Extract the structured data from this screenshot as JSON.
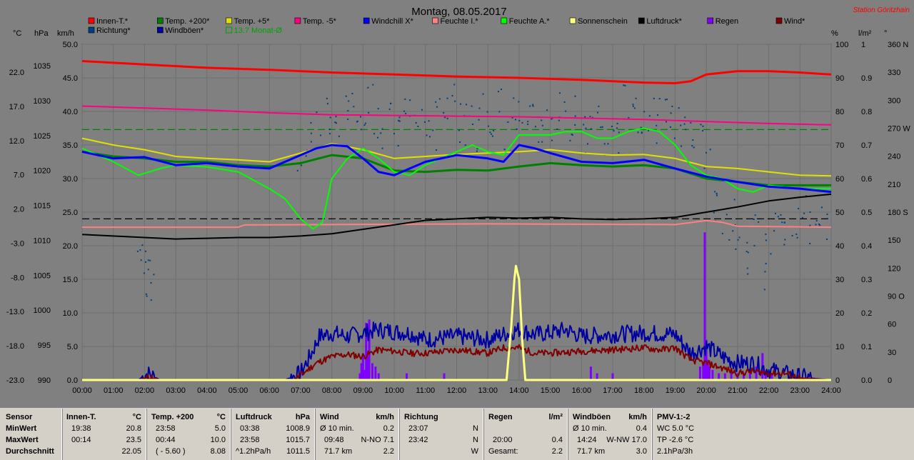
{
  "title": "Montag, 08.05.2017",
  "station": "Station Göritzhain",
  "legend": [
    {
      "label": "Innen-T.*",
      "color": "#ff0000"
    },
    {
      "label": "Temp. +200*",
      "color": "#008000"
    },
    {
      "label": "Temp. +5*",
      "color": "#e0e000"
    },
    {
      "label": "Temp. -5*",
      "color": "#ff0080"
    },
    {
      "label": "Windchill X*",
      "color": "#0000ff"
    },
    {
      "label": "Feuchte I.*",
      "color": "#ff8080"
    },
    {
      "label": "Feuchte A.*",
      "color": "#00ff00"
    },
    {
      "label": "Sonnenschein",
      "color": "#ffff80"
    },
    {
      "label": "Luftdruck*",
      "color": "#000000"
    },
    {
      "label": "Regen",
      "color": "#8000ff"
    },
    {
      "label": "Wind*",
      "color": "#800000"
    },
    {
      "label": "Richtung*",
      "color": "#004080"
    },
    {
      "label": "Windböen*",
      "color": "#0000a0"
    },
    {
      "label": "13.7 Monat-Ø",
      "color": "#00a000",
      "open": true
    }
  ],
  "axis_units": {
    "c": "°C",
    "hpa": "hPa",
    "kmh": "km/h",
    "pct": "%",
    "lm2": "l/m²",
    "deg": "°"
  },
  "chart_data": {
    "type": "line",
    "x_ticks": [
      "00:00",
      "01:00",
      "02:00",
      "03:00",
      "04:00",
      "05:00",
      "06:00",
      "07:00",
      "08:00",
      "09:00",
      "10:00",
      "11:00",
      "12:00",
      "13:00",
      "14:00",
      "15:00",
      "16:00",
      "17:00",
      "18:00",
      "19:00",
      "20:00",
      "21:00",
      "22:00",
      "23:00",
      "24:00"
    ],
    "y_axes": {
      "celsius": [
        "22.0",
        "17.0",
        "12.0",
        "7.0",
        "2.0",
        "-3.0",
        "-8.0",
        "-13.0",
        "-18.0",
        "-23.0"
      ],
      "hpa": [
        "1035",
        "1030",
        "1025",
        "1020",
        "1015",
        "1010",
        "1005",
        "1000",
        "995",
        "990"
      ],
      "kmh": [
        "50.0",
        "45.0",
        "40.0",
        "35.0",
        "30.0",
        "25.0",
        "20.0",
        "15.0",
        "10.0",
        "5.0",
        "0.0"
      ],
      "percent": [
        "100",
        "90",
        "80",
        "70",
        "60",
        "50",
        "40",
        "30",
        "20",
        "10",
        "0"
      ],
      "lm2": [
        "1",
        "0.9",
        "0.8",
        "0.7",
        "0.6",
        "0.5",
        "0.4",
        "0.3",
        "0.2",
        "0.1",
        "0.0"
      ],
      "degrees": [
        "360 N",
        "330",
        "300",
        "270 W",
        "240",
        "210",
        "180 S",
        "150",
        "120",
        "90 O",
        "60",
        "30",
        "0"
      ]
    },
    "ranges": {
      "celsius": [
        -23,
        22
      ],
      "hpa": [
        990,
        1035
      ],
      "kmh": [
        0,
        50
      ],
      "percent": [
        0,
        100
      ],
      "lm2": [
        0,
        1
      ],
      "degrees": [
        0,
        360
      ]
    },
    "hlines": [
      {
        "name": "13.7 Monat-Ø",
        "axis": "kmh",
        "value": 37.3,
        "color": "#008000",
        "dash": true
      },
      {
        "name": "",
        "axis": "kmh",
        "value": 24.0,
        "color": "#000000",
        "dash": true
      }
    ],
    "series": [
      {
        "name": "Innen-T.*",
        "axis": "kmh",
        "color": "#ff0000",
        "width": 3,
        "x": [
          0,
          2,
          4,
          6,
          8,
          10,
          12,
          14,
          16,
          18,
          19,
          19.5,
          20,
          21,
          22,
          23,
          24
        ],
        "y": [
          47.5,
          47.0,
          46.5,
          46.2,
          45.8,
          45.5,
          45.2,
          45.0,
          44.7,
          44.3,
          44.2,
          44.5,
          45.5,
          46.0,
          46.0,
          45.8,
          45.5
        ]
      },
      {
        "name": "Temp. -5*",
        "axis": "kmh",
        "color": "#ff0080",
        "width": 2,
        "x": [
          0,
          2,
          4,
          6,
          8,
          10,
          12,
          14,
          16,
          18,
          20,
          22,
          24
        ],
        "y": [
          40.8,
          40.5,
          40.2,
          39.8,
          39.5,
          39.4,
          39.3,
          39.2,
          39.0,
          38.8,
          38.5,
          38.2,
          38.0
        ]
      },
      {
        "name": "Feuchte I.*",
        "axis": "percent",
        "color": "#ff8080",
        "width": 2,
        "x": [
          0,
          5,
          5.2,
          13,
          19,
          20,
          20.5,
          21,
          24
        ],
        "y": [
          45.5,
          45.5,
          46.2,
          46.5,
          46.3,
          47.5,
          47.0,
          45.8,
          45.5
        ]
      },
      {
        "name": "Luftdruck*",
        "axis": "hpa",
        "color": "#000000",
        "width": 2,
        "x": [
          0,
          2,
          3,
          4,
          5,
          6,
          7,
          8,
          9,
          10,
          11,
          12,
          13,
          14,
          15,
          16,
          17,
          18,
          19,
          20,
          21,
          22,
          23,
          24
        ],
        "y": [
          1009.5,
          1009.1,
          1008.9,
          1009.0,
          1009.1,
          1009.1,
          1009.3,
          1009.6,
          1010.2,
          1010.8,
          1011.4,
          1011.6,
          1011.8,
          1011.7,
          1011.8,
          1011.6,
          1011.5,
          1011.6,
          1011.8,
          1012.5,
          1013.2,
          1014.0,
          1014.5,
          1014.9
        ]
      },
      {
        "name": "Temp. +5*",
        "axis": "kmh",
        "color": "#e0e000",
        "width": 2,
        "x": [
          0,
          1,
          2,
          3,
          4,
          5,
          6,
          7,
          8,
          9,
          10,
          11,
          12,
          13,
          14,
          15,
          16,
          17,
          18,
          19,
          20,
          21,
          22,
          23,
          24
        ],
        "y": [
          36.0,
          35.0,
          34.3,
          33.3,
          33.0,
          32.8,
          32.5,
          33.8,
          35.2,
          34.3,
          33.0,
          33.3,
          33.6,
          33.8,
          34.0,
          34.3,
          33.8,
          33.5,
          33.6,
          33.0,
          31.8,
          31.5,
          31.0,
          30.5,
          30.4
        ]
      },
      {
        "name": "Temp. +200*",
        "axis": "kmh",
        "color": "#008000",
        "width": 3,
        "x": [
          0,
          1,
          2,
          3,
          4,
          5,
          6,
          7,
          8,
          9,
          10,
          11,
          12,
          13,
          14,
          15,
          16,
          17,
          18,
          19,
          20,
          21,
          22,
          23,
          24
        ],
        "y": [
          34.0,
          33.3,
          33.0,
          32.5,
          32.5,
          32.0,
          31.8,
          32.3,
          33.5,
          33.0,
          31.2,
          31.0,
          31.3,
          31.2,
          31.8,
          32.3,
          32.0,
          31.8,
          32.0,
          31.5,
          30.0,
          29.5,
          29.0,
          29.0,
          29.0
        ]
      },
      {
        "name": "Feuchte A.*",
        "axis": "percent",
        "color": "#00ff00",
        "width": 2,
        "x": [
          0,
          0.5,
          1,
          1.8,
          2.5,
          3,
          4,
          5,
          6,
          6.5,
          7,
          7.4,
          7.7,
          8,
          8.5,
          9,
          9.5,
          10,
          10.5,
          11,
          12,
          12.5,
          13,
          13.5,
          14,
          14.5,
          15,
          15.5,
          16,
          16.5,
          17,
          17.5,
          18,
          18.5,
          19,
          19.5,
          20,
          20.5,
          21,
          21.5,
          22,
          23,
          24
        ],
        "y": [
          69,
          67,
          65,
          61,
          63,
          64,
          63.5,
          62,
          57,
          54,
          48,
          45,
          47,
          60,
          66,
          69,
          66,
          62,
          61,
          64,
          68,
          70,
          68,
          67,
          73,
          73,
          73,
          74,
          74,
          72,
          72,
          74,
          75,
          74,
          70,
          64,
          61,
          60,
          57,
          56,
          58,
          57,
          57
        ]
      },
      {
        "name": "Windchill X*",
        "axis": "kmh",
        "color": "#0000ff",
        "width": 3,
        "x": [
          0,
          1,
          2,
          3,
          4,
          5,
          6,
          7,
          7.5,
          8,
          8.5,
          9,
          9.5,
          10,
          10.5,
          11,
          12,
          13,
          13.5,
          14,
          14.5,
          15,
          16,
          17,
          18,
          19,
          20,
          21,
          22,
          23,
          24
        ],
        "y": [
          34.0,
          33.0,
          33.2,
          32.0,
          32.3,
          31.8,
          31.5,
          33.5,
          34.5,
          35.0,
          34.8,
          33.0,
          31.0,
          30.5,
          31.5,
          32.5,
          33.5,
          33.0,
          32.5,
          35.0,
          34.5,
          33.8,
          32.5,
          32.3,
          32.8,
          31.5,
          30.3,
          29.5,
          28.8,
          28.5,
          28.0
        ]
      },
      {
        "name": "Windböen*",
        "axis": "kmh",
        "color": "#0000a0",
        "width": 2,
        "noise": 1.3,
        "seed": 7,
        "x": [
          0,
          1.8,
          2.1,
          2.5,
          3,
          4,
          5,
          6,
          6.5,
          7,
          7.3,
          7.6,
          8,
          8.5,
          9,
          9.5,
          10,
          10.5,
          11,
          12,
          13,
          13.5,
          14,
          14.5,
          15,
          15.5,
          16,
          17,
          18,
          19,
          19.5,
          20,
          20.5,
          21,
          21.5,
          22,
          22.5,
          23,
          23.5,
          24
        ],
        "y": [
          0,
          0,
          1.0,
          0,
          0,
          0,
          0,
          0,
          0,
          1.0,
          3.5,
          6.5,
          7.0,
          6.5,
          7.0,
          7.5,
          7.2,
          7.0,
          6.0,
          6.5,
          6.0,
          6.8,
          7.5,
          6.8,
          7.0,
          7.5,
          6.5,
          6.8,
          7.0,
          6.8,
          4.0,
          5.0,
          3.5,
          2.5,
          2.5,
          1.5,
          1.0,
          0.5,
          0.2,
          0
        ]
      },
      {
        "name": "Wind*",
        "axis": "kmh",
        "color": "#800000",
        "width": 2,
        "noise": 0.5,
        "seed": 11,
        "x": [
          0,
          1.8,
          2.2,
          2.5,
          3,
          6,
          6.8,
          7.5,
          8,
          8.5,
          9,
          9.5,
          10,
          10.5,
          11,
          12,
          13,
          13.5,
          14,
          14.5,
          15,
          16,
          17,
          18,
          18.5,
          19,
          19.5,
          20,
          20.5,
          21,
          21.5,
          22,
          22.5,
          23,
          24
        ],
        "y": [
          0,
          0,
          0.5,
          0,
          0,
          0,
          0,
          2.5,
          3.5,
          3.8,
          3.5,
          4.5,
          4.3,
          4.0,
          4.0,
          4.5,
          4.0,
          4.8,
          4.8,
          4.0,
          4.0,
          4.3,
          4.5,
          4.8,
          4.5,
          4.8,
          3.0,
          2.5,
          1.8,
          1.0,
          1.3,
          1.0,
          1.0,
          0.3,
          0
        ]
      },
      {
        "name": "Sonnenschein",
        "axis": "kmh",
        "color": "#ffff80",
        "width": 3,
        "x": [
          0,
          13.6,
          13.75,
          13.85,
          13.9,
          14.0,
          14.1,
          14.2,
          24
        ],
        "y": [
          0,
          0,
          8,
          15,
          17,
          15,
          6,
          0,
          0
        ]
      }
    ],
    "bars": {
      "name": "Regen",
      "axis": "lm2",
      "color": "#8000ff",
      "x": [
        8.9,
        8.95,
        9.0,
        9.05,
        9.1,
        9.15,
        9.2,
        9.3,
        9.4,
        9.5,
        10.4,
        11.6,
        16.3,
        16.5,
        17.0,
        19.8,
        19.9,
        19.95,
        20.0,
        20.05,
        20.1,
        20.2,
        20.4,
        20.6,
        20.8,
        21.0,
        21.2,
        21.4,
        21.6,
        21.8,
        21.9,
        22.1
      ],
      "y": [
        0.02,
        0.05,
        0.08,
        0.03,
        0.17,
        0.07,
        0.18,
        0.05,
        0.04,
        0.02,
        0.02,
        0.02,
        0.04,
        0.02,
        0.02,
        0.04,
        0.05,
        0.44,
        0.12,
        0.06,
        0.04,
        0.03,
        0.02,
        0.02,
        0.03,
        0.02,
        0.02,
        0.03,
        0.04,
        0.08,
        0.02,
        0.02
      ]
    },
    "scatter": {
      "name": "Richtung*",
      "axis": "degrees",
      "color": "#004080",
      "seed": 3,
      "x": [
        1.8,
        1.9,
        2.0,
        2.1,
        2.2,
        7.0,
        7.2,
        7.4,
        7.6,
        7.8,
        8.0,
        8.2,
        8.4,
        8.6,
        8.8,
        9.0,
        9.2,
        9.4,
        9.6,
        9.8,
        10.0,
        10.2,
        10.4,
        10.6,
        10.8,
        11.0,
        11.2,
        11.4,
        11.6,
        11.8,
        12.0,
        12.2,
        12.4,
        12.6,
        12.8,
        13.0,
        13.2,
        13.4,
        13.6,
        13.8,
        14.0,
        14.2,
        14.4,
        14.6,
        14.8,
        15.0,
        15.2,
        15.4,
        15.6,
        15.8,
        16.0,
        16.2,
        16.4,
        16.6,
        16.8,
        17.0,
        17.2,
        17.4,
        17.6,
        17.8,
        18.0,
        18.2,
        18.4,
        18.6,
        18.8,
        19.0,
        19.2,
        19.4,
        19.6,
        19.8,
        20.0,
        20.2,
        20.4,
        20.6,
        20.8,
        21.0,
        21.2,
        21.4,
        21.6,
        21.8,
        22.0,
        22.2,
        22.4,
        22.6,
        22.8,
        23.0,
        23.2,
        23.4,
        23.6,
        23.8
      ],
      "y": [
        150,
        130,
        110,
        100,
        120,
        230,
        260,
        250,
        270,
        285,
        265,
        280,
        300,
        290,
        270,
        285,
        300,
        275,
        260,
        290,
        270,
        295,
        305,
        300,
        275,
        280,
        265,
        290,
        275,
        300,
        280,
        270,
        285,
        265,
        290,
        275,
        280,
        295,
        265,
        300,
        285,
        270,
        280,
        265,
        290,
        275,
        285,
        300,
        270,
        290,
        260,
        265,
        280,
        275,
        255,
        285,
        260,
        300,
        290,
        280,
        275,
        285,
        270,
        300,
        290,
        280,
        265,
        275,
        240,
        260,
        230,
        200,
        185,
        160,
        175,
        140,
        120,
        130,
        165,
        110,
        150,
        180,
        160,
        150,
        170,
        175,
        185,
        160,
        180,
        170
      ]
    }
  },
  "stats": {
    "headers": {
      "sensor": "Sensor",
      "innen": "Innen-T.",
      "innen_u": "°C",
      "temp": "Temp. +200",
      "temp_u": "°C",
      "luft": "Luftdruck",
      "luft_u": "hPa",
      "wind": "Wind",
      "wind_u": "km/h",
      "richt": "Richtung",
      "regen": "Regen",
      "regen_u": "l/m²",
      "boen": "Windböen",
      "boen_u": "km/h",
      "pmv": "PMV-1:-2"
    },
    "labels": {
      "min": "MinWert",
      "max": "MaxWert",
      "avg": "Durchschnitt"
    },
    "innen": {
      "min_t": "19:38",
      "min_v": "20.8",
      "max_t": "00:14",
      "max_v": "23.5",
      "avg_v": "22.05"
    },
    "temp": {
      "min_t": "23:58",
      "min_v": "5.0",
      "max_t": "00:44",
      "max_v": "10.0",
      "avg_t": "( - 5.60 )",
      "avg_v": "8.08"
    },
    "luft": {
      "min_t": "03:38",
      "min_v": "1008.9",
      "max_t": "23:58",
      "max_v": "1015.7",
      "avg_t": "^1.2hPa/h",
      "avg_v": "1011.5"
    },
    "wind": {
      "min_t": "Ø 10 min.",
      "min_v": "0.2",
      "max_t": "09:48",
      "max_v": "N-NO 7.1",
      "avg_t": "71.7 km",
      "avg_v": "2.2"
    },
    "richt": {
      "min_t": "23:07",
      "min_v": "N",
      "max_t": "23:42",
      "max_v": "N",
      "avg_v": "W"
    },
    "regen": {
      "max_t": "20:00",
      "max_v": "0.4",
      "avg_t": "Gesamt:",
      "avg_v": "2.2"
    },
    "boen": {
      "min_t": "Ø 10 min.",
      "min_v": "0.4",
      "max_t": "14:24",
      "max_v": "W-NW 17.0",
      "avg_t": "71.7 km",
      "avg_v": "3.0"
    },
    "pmv": {
      "l1": "WC 5.0 °C",
      "l2": "TP -2.6 °C",
      "l3": "2.1hPa/3h"
    }
  }
}
